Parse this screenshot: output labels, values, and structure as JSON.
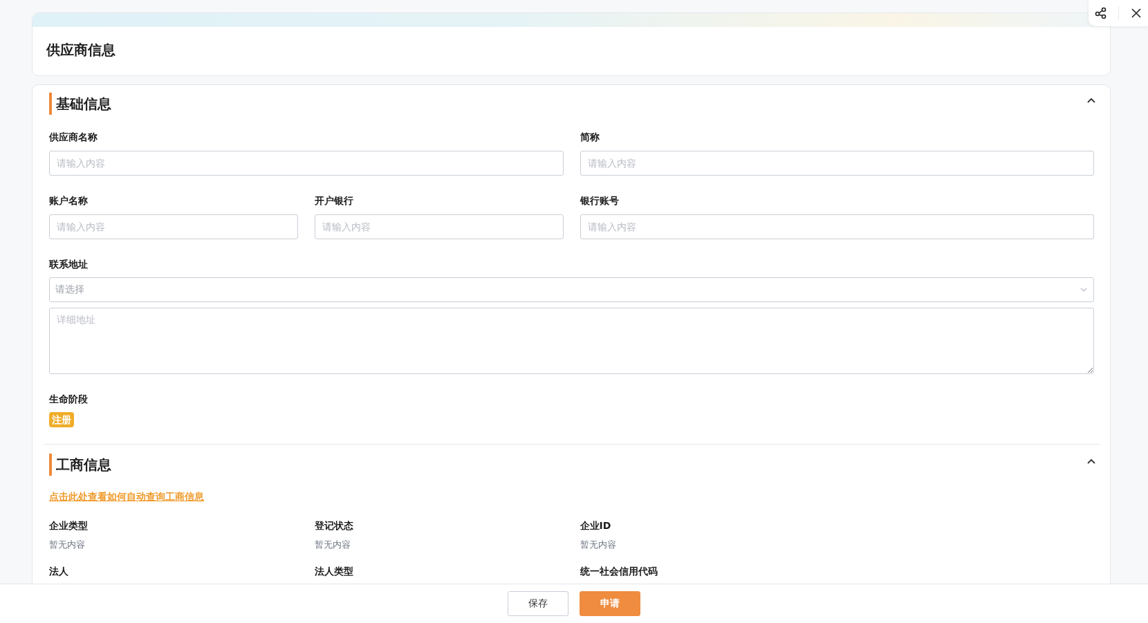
{
  "page": {
    "title": "供应商信息"
  },
  "basic": {
    "title": "基础信息",
    "expanded": true,
    "fields": [
      {
        "label": "供应商名称",
        "placeholder": "请输入内容",
        "kind": "wide"
      },
      {
        "label": "简称",
        "placeholder": "请输入内容",
        "kind": "wide"
      },
      {
        "label": "账户名称",
        "placeholder": "请输入内容",
        "kind": "narrow"
      },
      {
        "label": "开户银行",
        "placeholder": "请输入内容",
        "kind": "narrow"
      },
      {
        "label": "银行账号",
        "placeholder": "请输入内容",
        "kind": "wide"
      }
    ],
    "address": {
      "label": "联系地址",
      "select": {
        "placeholder": "请选择"
      },
      "detail": {
        "placeholder": "详细地址"
      }
    },
    "stage": {
      "label": "生命阶段",
      "tag": {
        "text": "注册",
        "color": "#f0ad2a"
      }
    }
  },
  "business": {
    "title": "工商信息",
    "expanded": true,
    "link": "点击此处查看如何自动查询工商信息",
    "items": [
      {
        "label": "企业类型",
        "value": "暂无内容"
      },
      {
        "label": "登记状态",
        "value": "暂无内容"
      },
      {
        "label": "企业ID",
        "value": "暂无内容"
      },
      {
        "label": "法人"
      },
      {
        "label": "法人类型"
      },
      {
        "label": "统一社会信用代码"
      }
    ]
  },
  "footer": {
    "buttons": [
      {
        "label": "保存",
        "kind": "secondary"
      },
      {
        "label": "申请",
        "kind": "primary"
      }
    ]
  }
}
